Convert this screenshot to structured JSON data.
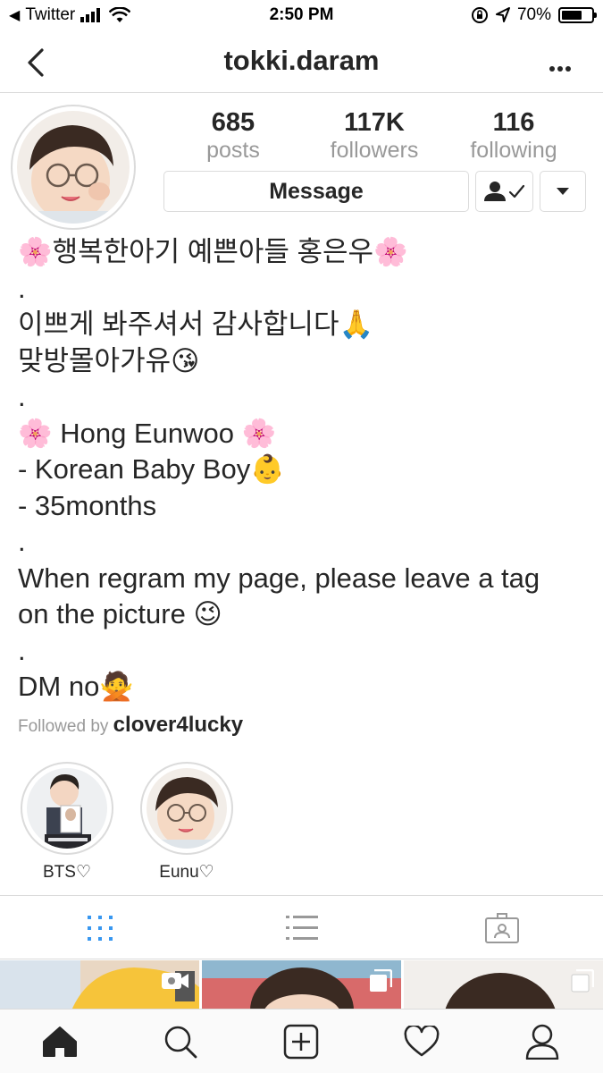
{
  "status_bar": {
    "carrier": "Twitter",
    "time": "2:50 PM",
    "battery": "70%",
    "battery_level": 0.7
  },
  "nav": {
    "title": "tokki.daram",
    "back_icon": "chevron-left-icon",
    "more_icon": "more-horizontal-icon"
  },
  "profile": {
    "stats": [
      {
        "value": "685",
        "label": "posts"
      },
      {
        "value": "117K",
        "label": "followers"
      },
      {
        "value": "116",
        "label": "following"
      }
    ],
    "message_label": "Message",
    "following_icon": "person-check-icon",
    "dropdown_icon": "caret-down-icon"
  },
  "bio": {
    "lines": [
      "🌸행복한아기 예쁜아들 홍은우🌸",
      ".",
      "이쁘게 봐주셔서 감사합니다🙏",
      "맞방몰아가유😘",
      ".",
      "🌸 Hong Eunwoo 🌸",
      "- Korean Baby Boy👶",
      "- 35months",
      ".",
      "When regram my page, please leave a tag on the picture 😉",
      ".",
      "DM no🙅"
    ]
  },
  "followed_by": {
    "prefix": "Followed by",
    "user": "clover4lucky"
  },
  "highlights": [
    {
      "label": "BTS♡"
    },
    {
      "label": "Eunu♡"
    }
  ],
  "tabs": [
    {
      "icon": "grid-icon",
      "active": true
    },
    {
      "icon": "list-icon",
      "active": false
    },
    {
      "icon": "tagged-icon",
      "active": false
    }
  ],
  "bottom_nav": [
    {
      "icon": "home-icon"
    },
    {
      "icon": "search-icon"
    },
    {
      "icon": "add-post-icon"
    },
    {
      "icon": "heart-icon"
    },
    {
      "icon": "profile-icon"
    }
  ],
  "colors": {
    "active_tab": "#3897f0",
    "border": "#dbdbdb",
    "secondary_text": "#999999"
  }
}
